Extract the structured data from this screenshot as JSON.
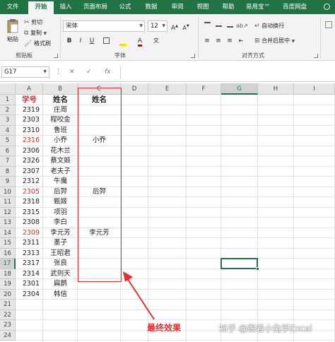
{
  "ribbon_tabs": [
    "文件",
    "开始",
    "插入",
    "页面布局",
    "公式",
    "数据",
    "审阅",
    "视图",
    "帮助",
    "易用宝™",
    "百度网盘"
  ],
  "active_tab": "开始",
  "clipboard": {
    "paste": "粘贴",
    "cut": "剪切",
    "copy": "复制",
    "format_painter": "格式刷",
    "group": "剪贴板"
  },
  "font": {
    "name": "宋体",
    "size": "12",
    "bold": "B",
    "italic": "I",
    "underline": "U",
    "wen": "文",
    "group": "字体"
  },
  "alignment": {
    "wrap": "自动换行",
    "merge": "合并后居中",
    "group": "对齐方式"
  },
  "formula_bar": {
    "name_box": "G17",
    "fx": "fx",
    "content": ""
  },
  "columns": [
    "A",
    "B",
    "C",
    "D",
    "E",
    "F",
    "G",
    "H",
    "I"
  ],
  "selected_column": "G",
  "rows": [
    "1",
    "2",
    "3",
    "4",
    "5",
    "6",
    "7",
    "8",
    "9",
    "10",
    "11",
    "12",
    "13",
    "14",
    "15",
    "16",
    "17",
    "18",
    "19",
    "20",
    "21",
    "22",
    "23",
    "24"
  ],
  "selected_row": "17",
  "header_row": {
    "a": "学号",
    "b": "姓名",
    "c": "姓名"
  },
  "data_rows": [
    {
      "id": "2319",
      "name": "庄周",
      "c": "",
      "red": false
    },
    {
      "id": "2303",
      "name": "程咬金",
      "c": "",
      "red": false
    },
    {
      "id": "2310",
      "name": "鲁班",
      "c": "",
      "red": false
    },
    {
      "id": "2316",
      "name": "小乔",
      "c": "小乔",
      "red": true
    },
    {
      "id": "2306",
      "name": "花木兰",
      "c": "",
      "red": false
    },
    {
      "id": "2326",
      "name": "蔡文姬",
      "c": "",
      "red": false
    },
    {
      "id": "2307",
      "name": "老夫子",
      "c": "",
      "red": false
    },
    {
      "id": "2312",
      "name": "牛魔",
      "c": "",
      "red": false
    },
    {
      "id": "2305",
      "name": "后羿",
      "c": "后羿",
      "red": true
    },
    {
      "id": "2318",
      "name": "甄姬",
      "c": "",
      "red": false
    },
    {
      "id": "2315",
      "name": "项羽",
      "c": "",
      "red": false
    },
    {
      "id": "2308",
      "name": "李白",
      "c": "",
      "red": false
    },
    {
      "id": "2309",
      "name": "李元芳",
      "c": "李元芳",
      "red": true
    },
    {
      "id": "2311",
      "name": "墨子",
      "c": "",
      "red": false
    },
    {
      "id": "2313",
      "name": "王昭君",
      "c": "",
      "red": false
    },
    {
      "id": "2317",
      "name": "张良",
      "c": "",
      "red": false
    },
    {
      "id": "2314",
      "name": "武则天",
      "c": "",
      "red": false
    },
    {
      "id": "2301",
      "name": "扁鹊",
      "c": "",
      "red": false
    },
    {
      "id": "2304",
      "name": "韩信",
      "c": "",
      "red": false
    }
  ],
  "annotation": "最终效果",
  "watermark": "知乎 @跟着小兔学Excel",
  "colors": {
    "accent": "#217346",
    "annotation": "#e03131",
    "red_text": "#c0392b"
  }
}
